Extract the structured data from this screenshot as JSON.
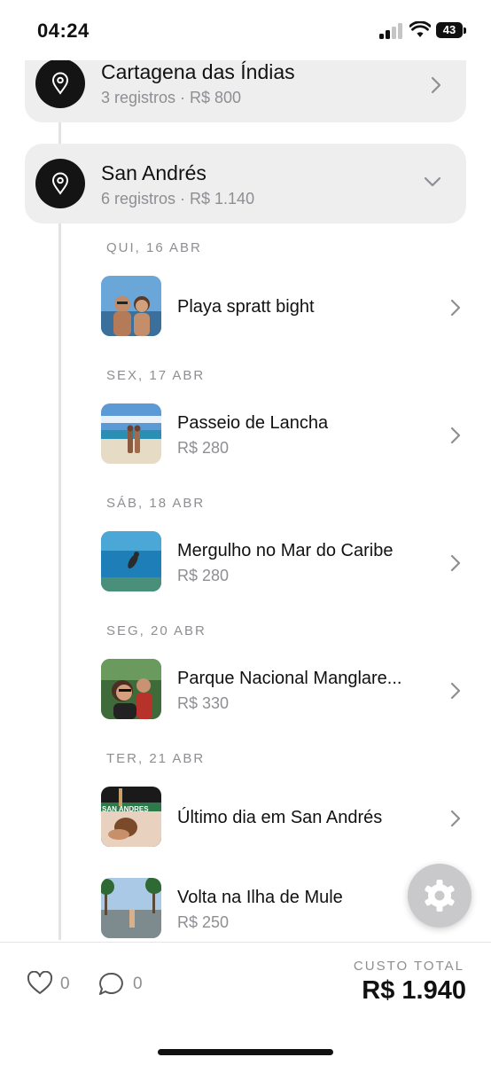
{
  "status_bar": {
    "time": "04:24",
    "battery": "43"
  },
  "places": [
    {
      "name": "Cartagena das Índias",
      "meta": "3 registros · R$ 800",
      "expanded": false
    },
    {
      "name": "San Andrés",
      "meta": "6 registros · R$ 1.140",
      "expanded": true
    }
  ],
  "days": [
    {
      "label": "QUI, 16 ABR",
      "record": {
        "title": "Playa spratt bight",
        "price": ""
      }
    },
    {
      "label": "SEX, 17 ABR",
      "record": {
        "title": "Passeio de Lancha",
        "price": "R$ 280"
      }
    },
    {
      "label": "SÁB, 18 ABR",
      "record": {
        "title": "Mergulho no Mar do Caribe",
        "price": "R$ 280"
      }
    },
    {
      "label": "SEG, 20 ABR",
      "record": {
        "title": "Parque Nacional Manglare...",
        "price": "R$ 330"
      }
    },
    {
      "label": "TER, 21 ABR",
      "record": {
        "title": "Último dia em San Andrés",
        "price": ""
      }
    }
  ],
  "extra_record": {
    "title": "Volta na Ilha de Mule",
    "price": "R$ 250"
  },
  "photo_sign_text": "SAN ANDRES",
  "bottom": {
    "likes": "0",
    "comments": "0",
    "total_label": "CUSTO TOTAL",
    "total_value": "R$ 1.940"
  },
  "icons": {
    "place": "map-pin-icon",
    "chevron_right": "chevron-right-icon",
    "chevron_down": "chevron-down-icon",
    "like": "heart-icon",
    "comment": "comment-icon",
    "settings": "gear-icon"
  },
  "colors": {
    "pin_bg": "#141414",
    "card_bg": "#eeeeef",
    "muted": "#8e8e93",
    "fab_bg": "#c9c9cb"
  }
}
